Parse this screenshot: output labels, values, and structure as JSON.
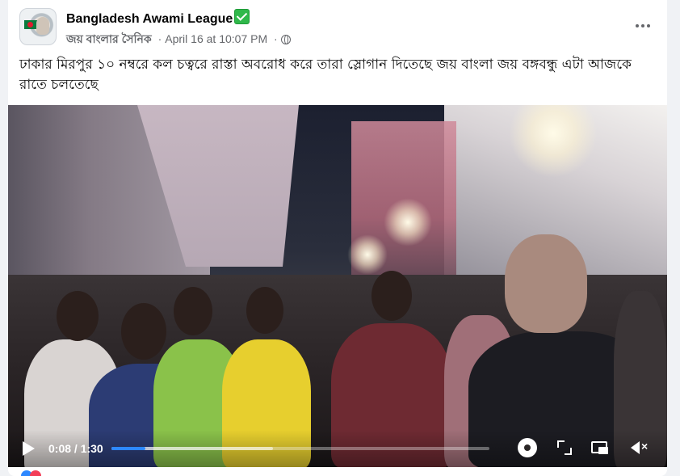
{
  "post": {
    "page_name": "Bangladesh Awami League",
    "verified_icon": "check-mark-emoji",
    "group_name": "জয় বাংলার সৈনিক",
    "separator": "·",
    "timestamp": "April 16 at 10:07 PM",
    "privacy_icon": "globe-icon",
    "text": "ঢাকার মিরপুর ১০ নম্বরে কল চত্বরে রাস্তা অবরোধ করে তারা স্লোগান দিতেছে জয় বাংলা জয় বঙ্গবন্ধু এটা আজকে রাতে চলতেছে"
  },
  "video": {
    "current_time": "0:08",
    "duration": "1:30",
    "time_display": "0:08 / 1:30",
    "progress_fraction": 0.089,
    "controls": [
      "play-icon",
      "settings-gear-icon",
      "fullscreen-icon",
      "picture-in-picture-icon",
      "muted-speaker-icon"
    ]
  },
  "colors": {
    "progress_played": "#2d88ff",
    "verified_badge": "#2fb84a",
    "meta_text": "#65676b"
  }
}
